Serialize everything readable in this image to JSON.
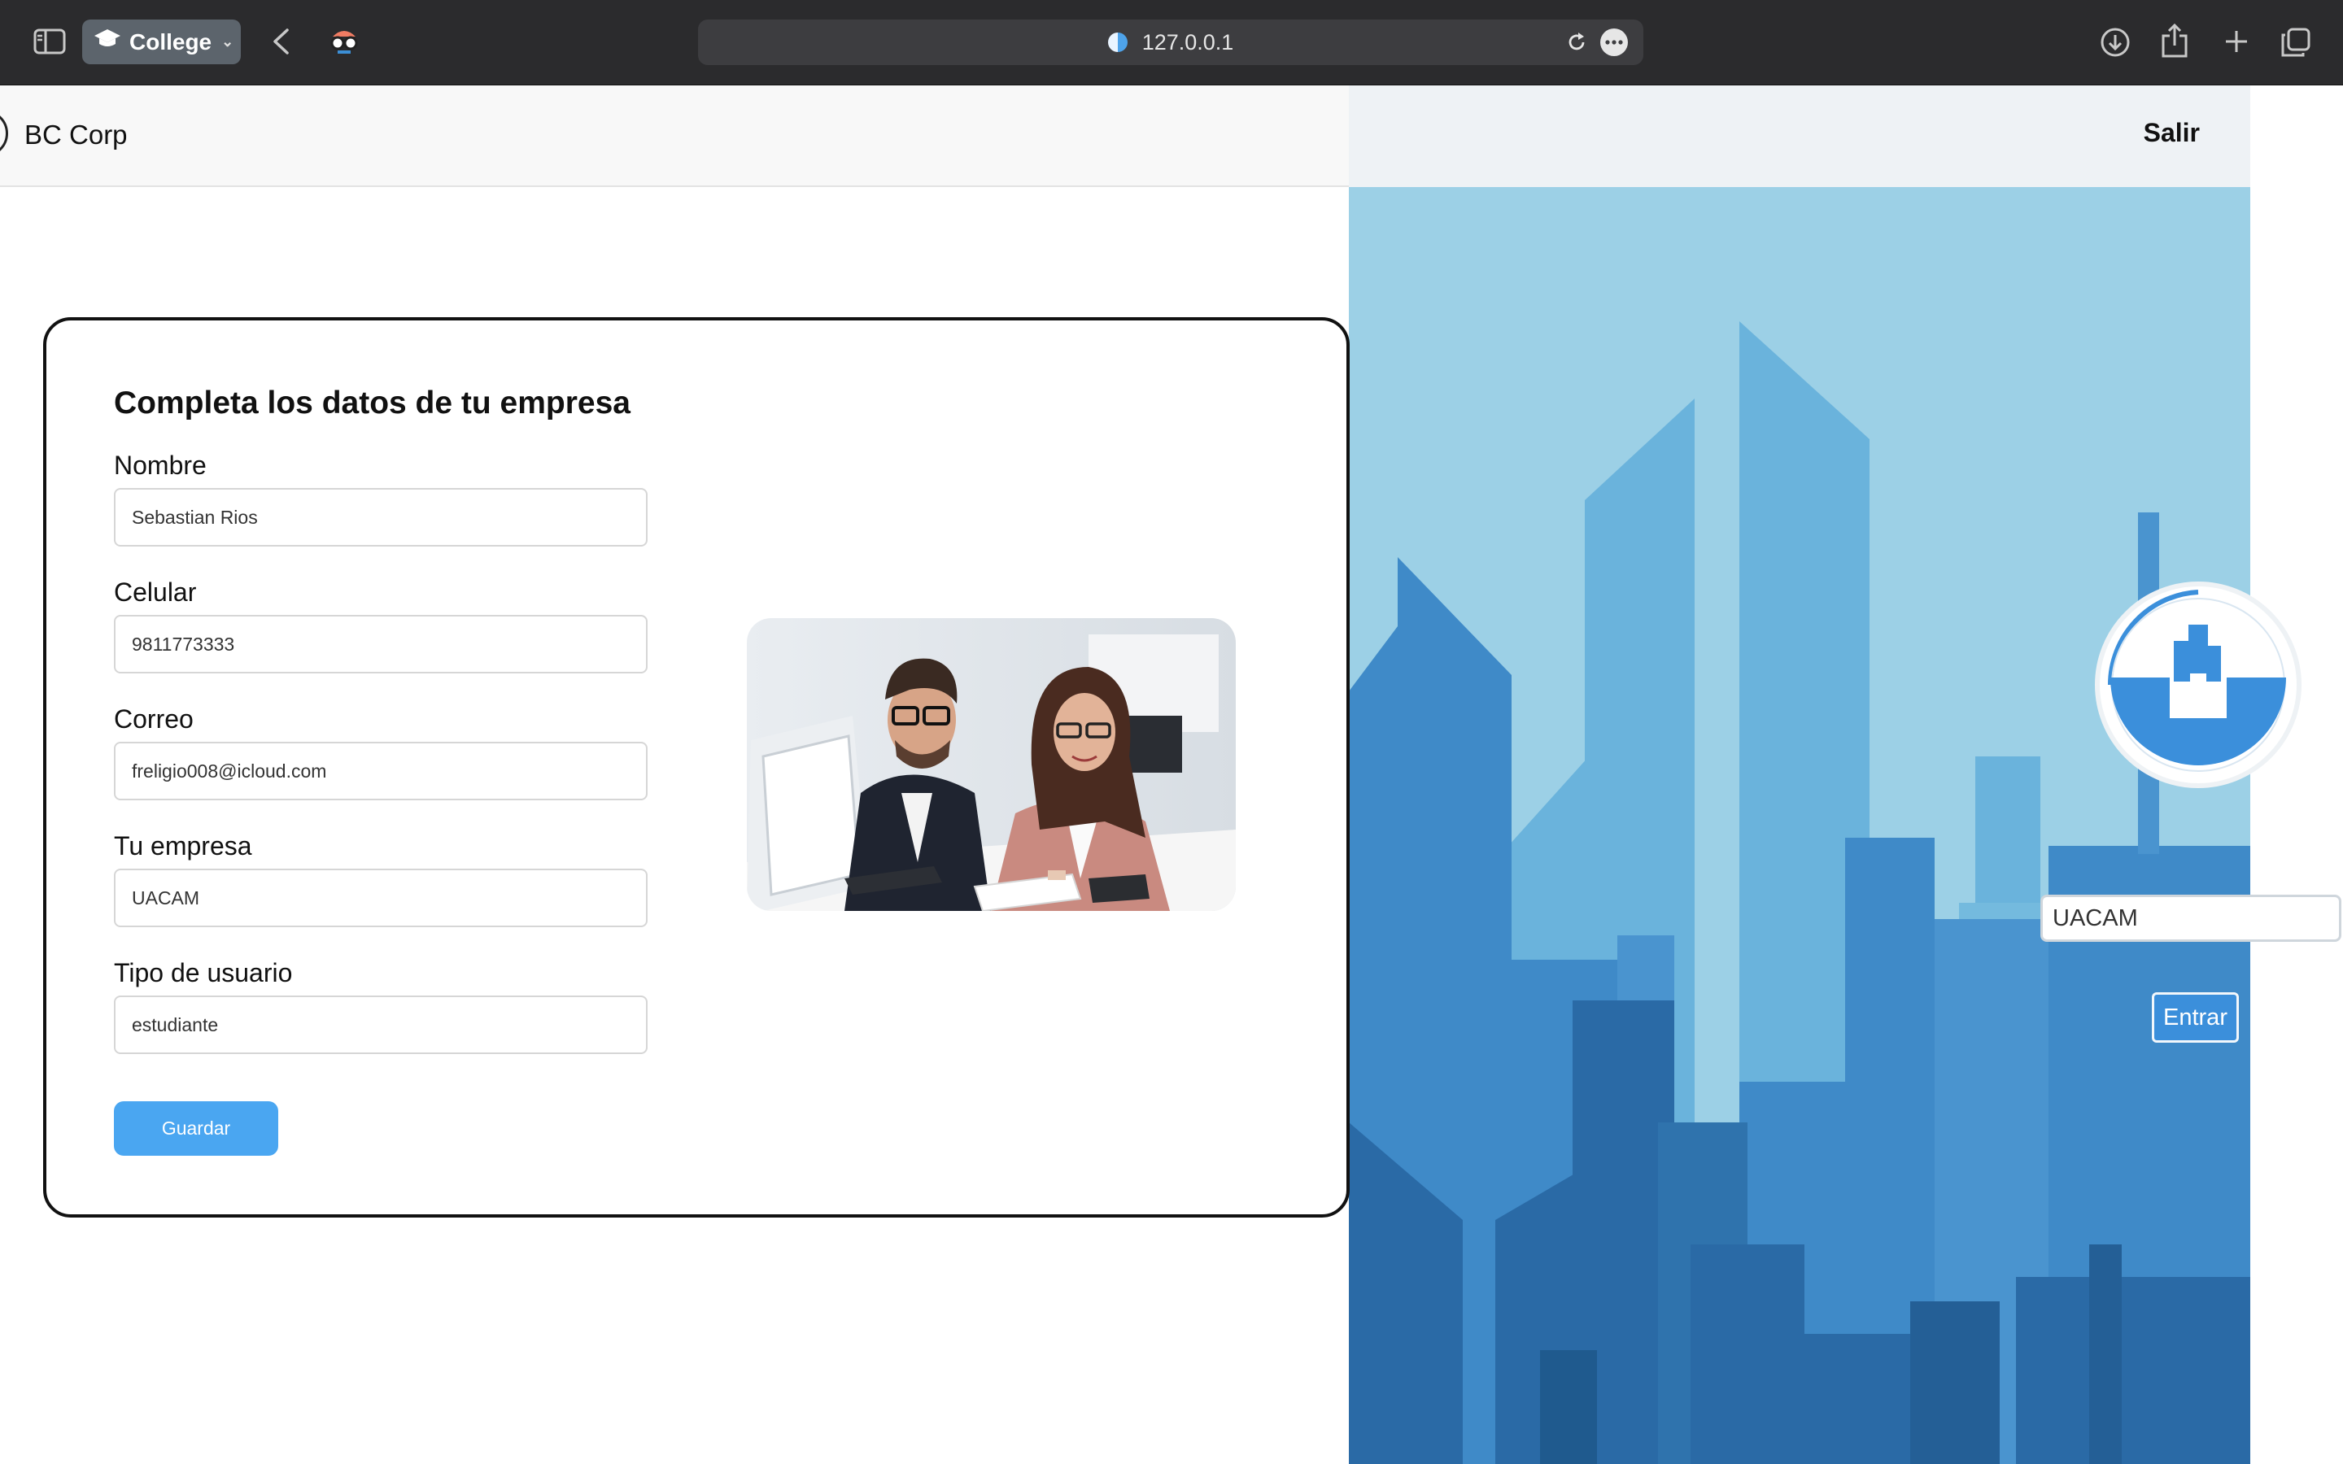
{
  "browser": {
    "profile_label": "College",
    "url": "127.0.0.1",
    "icons": [
      "sidebar-icon",
      "graduation-cap-icon",
      "chevron-down-icon",
      "back-arrow-icon",
      "extension-icon",
      "site-icon",
      "reload-icon",
      "more-icon",
      "download-icon",
      "share-icon",
      "plus-icon",
      "tabs-icon"
    ]
  },
  "header": {
    "brand": "BC Corp",
    "logout_label": "Salir"
  },
  "form": {
    "title": "Completa los datos de tu empresa",
    "fields": [
      {
        "label": "Nombre",
        "value": "Sebastian Rios"
      },
      {
        "label": "Celular",
        "value": "9811773333"
      },
      {
        "label": "Correo",
        "value": "freligio008@icloud.com"
      },
      {
        "label": "Tu empresa",
        "value": "UACAM"
      },
      {
        "label": "Tipo de usuario",
        "value": "estudiante"
      }
    ],
    "save_label": "Guardar"
  },
  "side_panel": {
    "company_value": "UACAM",
    "enter_label": "Entrar"
  },
  "colors": {
    "accent": "#4aa6f1",
    "sky": "#9cd0e6",
    "building_light": "#6ab3dc",
    "building_mid": "#3f8ac8",
    "building_dark": "#2a6aa6"
  }
}
